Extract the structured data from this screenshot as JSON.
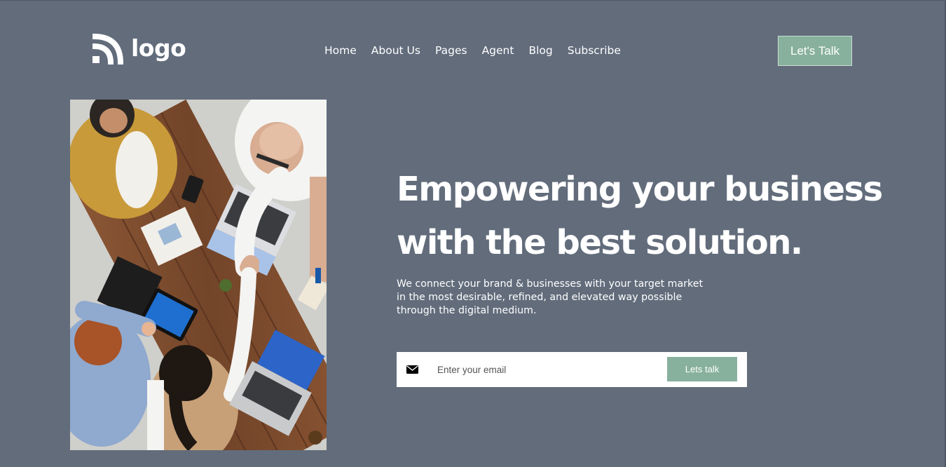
{
  "brand": {
    "logo_text": "logo",
    "logo_icon": "wifi-arcs-icon"
  },
  "nav": {
    "items": [
      {
        "label": "Home"
      },
      {
        "label": "About Us"
      },
      {
        "label": "Pages"
      },
      {
        "label": "Agent"
      },
      {
        "label": "Blog"
      },
      {
        "label": "Subscribe"
      }
    ],
    "cta_label": "Let's Talk"
  },
  "hero": {
    "headline_line1": "Empowering your business",
    "headline_line2": "with the best solution.",
    "sub_line1": "We connect your brand & businesses with your target market",
    "sub_line2": "in the most desirable, refined, and elevated way possible",
    "sub_line3": "through the digital medium."
  },
  "form": {
    "icon": "envelope-icon",
    "email_placeholder": "Enter your email",
    "email_value": "",
    "submit_label": "Lets talk"
  },
  "colors": {
    "background": "#626c7b",
    "accent": "#88b19d",
    "text": "#ffffff"
  }
}
